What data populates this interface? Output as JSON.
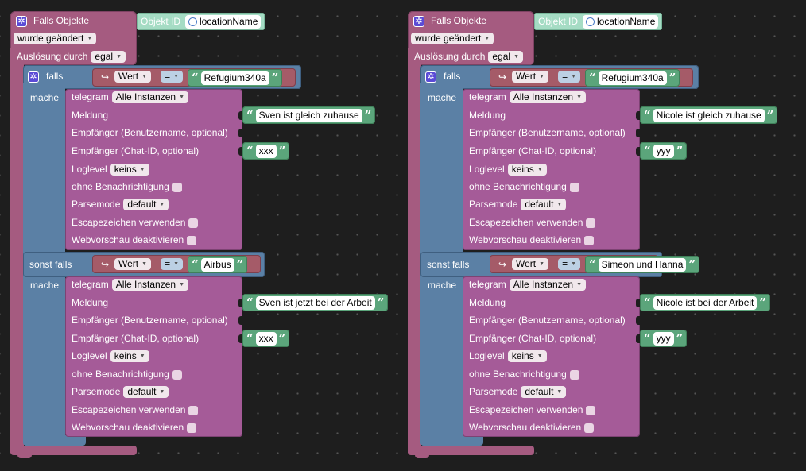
{
  "labels": {
    "when_objects": "Falls Objekte",
    "object_id": "Objekt ID",
    "changed": "wurde geändert",
    "trigger_by": "Auslösung durch",
    "trigger_value": "egal",
    "if": "falls",
    "else_if": "sonst falls",
    "do": "mache",
    "value": "Wert",
    "equals": "=",
    "telegram": "telegram",
    "all_instances": "Alle Instanzen",
    "message": "Meldung",
    "recipient_user": "Empfänger (Benutzername, optional)",
    "recipient_chat": "Empfänger (Chat-ID, optional)",
    "loglevel": "Loglevel",
    "loglevel_value": "keins",
    "no_notify": "ohne Benachrichtigung",
    "parsemode": "Parsemode",
    "parsemode_value": "default",
    "escape": "Escapezeichen verwenden",
    "webpreview": "Webvorschau deaktivieren",
    "quote_open": "“",
    "quote_close": "”"
  },
  "programs": [
    {
      "object_name": "locationName",
      "if_value": "Refugium340a",
      "if_message": "Sven ist gleich zuhause",
      "if_chat_id": "xxx",
      "elseif_value": "Airbus",
      "elseif_message": "Sven ist jetzt bei der Arbeit",
      "elseif_chat_id": "xxx"
    },
    {
      "object_name": "locationName",
      "if_value": "Refugium340a",
      "if_message": "Nicole ist gleich zuhause",
      "if_chat_id": "yyy",
      "elseif_value": "Simeon und Hanna",
      "elseif_message": "Nicole ist bei der Arbeit",
      "elseif_chat_id": "yyy"
    }
  ]
}
